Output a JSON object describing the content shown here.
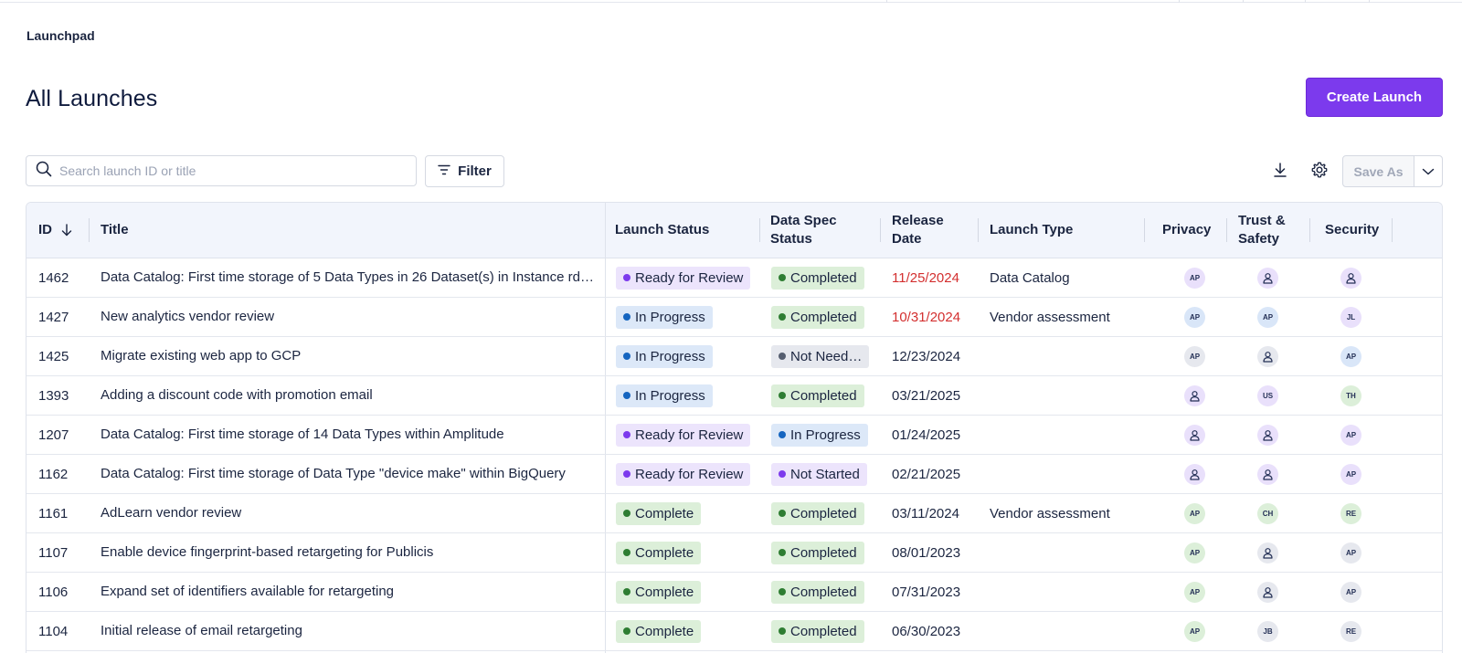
{
  "breadcrumb": "Launchpad",
  "page_title": "All Launches",
  "create_button": "Create Launch",
  "search": {
    "placeholder": "Search launch ID or title"
  },
  "filter_label": "Filter",
  "save_as_label": "Save As",
  "colors": {
    "accent": "#7c3aed",
    "overdue": "#d32f2f",
    "header_bg": "#f2f5fc"
  },
  "columns": {
    "id": "ID",
    "title": "Title",
    "launch_status": "Launch Status",
    "data_spec_status_1": "Data Spec",
    "data_spec_status_2": "Status",
    "release_date_1": "Release",
    "release_date_2": "Date",
    "launch_type": "Launch Type",
    "privacy": "Privacy",
    "trust_1": "Trust &",
    "trust_2": "Safety",
    "security": "Security"
  },
  "rows": [
    {
      "id": "1462",
      "title": "Data Catalog: First time storage of 5 Data Types in 26 Dataset(s) in Instance rds-s…",
      "launch_status": "Ready for Review",
      "launch_color": "purple",
      "data_spec": "Completed",
      "data_color": "green",
      "release_date": "11/25/2024",
      "overdue": true,
      "launch_type": "Data Catalog",
      "privacy": {
        "initials": "AP",
        "color": "purple",
        "icon": false
      },
      "trust": {
        "initials": "",
        "color": "purple",
        "icon": true
      },
      "security": {
        "initials": "",
        "color": "purple",
        "icon": true
      }
    },
    {
      "id": "1427",
      "title": "New analytics vendor review",
      "launch_status": "In Progress",
      "launch_color": "blue",
      "data_spec": "Completed",
      "data_color": "green",
      "release_date": "10/31/2024",
      "overdue": true,
      "launch_type": "Vendor assessment",
      "privacy": {
        "initials": "AP",
        "color": "blue",
        "icon": false
      },
      "trust": {
        "initials": "AP",
        "color": "blue",
        "icon": false
      },
      "security": {
        "initials": "JL",
        "color": "purple",
        "icon": false
      }
    },
    {
      "id": "1425",
      "title": "Migrate existing web app to GCP",
      "launch_status": "In Progress",
      "launch_color": "blue",
      "data_spec": "Not Need…",
      "data_color": "gray",
      "release_date": "12/23/2024",
      "overdue": false,
      "launch_type": "",
      "privacy": {
        "initials": "AP",
        "color": "gray",
        "icon": false
      },
      "trust": {
        "initials": "",
        "color": "gray",
        "icon": true
      },
      "security": {
        "initials": "AP",
        "color": "blue",
        "icon": false
      }
    },
    {
      "id": "1393",
      "title": "Adding a discount code with promotion email",
      "launch_status": "In Progress",
      "launch_color": "blue",
      "data_spec": "Completed",
      "data_color": "green",
      "release_date": "03/21/2025",
      "overdue": false,
      "launch_type": "",
      "privacy": {
        "initials": "",
        "color": "purple",
        "icon": true
      },
      "trust": {
        "initials": "US",
        "color": "purple",
        "icon": false
      },
      "security": {
        "initials": "TH",
        "color": "green",
        "icon": false
      }
    },
    {
      "id": "1207",
      "title": "Data Catalog: First time storage of 14 Data Types within Amplitude",
      "launch_status": "Ready for Review",
      "launch_color": "purple",
      "data_spec": "In Progress",
      "data_color": "blue",
      "release_date": "01/24/2025",
      "overdue": false,
      "launch_type": "",
      "privacy": {
        "initials": "",
        "color": "purple",
        "icon": true
      },
      "trust": {
        "initials": "",
        "color": "purple",
        "icon": true
      },
      "security": {
        "initials": "AP",
        "color": "purple",
        "icon": false
      }
    },
    {
      "id": "1162",
      "title": "Data Catalog: First time storage of Data Type \"device make\" within BigQuery",
      "launch_status": "Ready for Review",
      "launch_color": "purple",
      "data_spec": "Not Started",
      "data_color": "purple",
      "release_date": "02/21/2025",
      "overdue": false,
      "launch_type": "",
      "privacy": {
        "initials": "",
        "color": "purple",
        "icon": true
      },
      "trust": {
        "initials": "",
        "color": "purple",
        "icon": true
      },
      "security": {
        "initials": "AP",
        "color": "purple",
        "icon": false
      }
    },
    {
      "id": "1161",
      "title": "AdLearn vendor review",
      "launch_status": "Complete",
      "launch_color": "green",
      "data_spec": "Completed",
      "data_color": "green",
      "release_date": "03/11/2024",
      "overdue": false,
      "launch_type": "Vendor assessment",
      "privacy": {
        "initials": "AP",
        "color": "green",
        "icon": false
      },
      "trust": {
        "initials": "CH",
        "color": "green",
        "icon": false
      },
      "security": {
        "initials": "RE",
        "color": "green",
        "icon": false
      }
    },
    {
      "id": "1107",
      "title": "Enable device fingerprint-based retargeting for Publicis",
      "launch_status": "Complete",
      "launch_color": "green",
      "data_spec": "Completed",
      "data_color": "green",
      "release_date": "08/01/2023",
      "overdue": false,
      "launch_type": "",
      "privacy": {
        "initials": "AP",
        "color": "green",
        "icon": false
      },
      "trust": {
        "initials": "",
        "color": "gray",
        "icon": true
      },
      "security": {
        "initials": "AP",
        "color": "gray",
        "icon": false
      }
    },
    {
      "id": "1106",
      "title": "Expand set of identifiers available for retargeting",
      "launch_status": "Complete",
      "launch_color": "green",
      "data_spec": "Completed",
      "data_color": "green",
      "release_date": "07/31/2023",
      "overdue": false,
      "launch_type": "",
      "privacy": {
        "initials": "AP",
        "color": "green",
        "icon": false
      },
      "trust": {
        "initials": "",
        "color": "gray",
        "icon": true
      },
      "security": {
        "initials": "AP",
        "color": "gray",
        "icon": false
      }
    },
    {
      "id": "1104",
      "title": "Initial release of email retargeting",
      "launch_status": "Complete",
      "launch_color": "green",
      "data_spec": "Completed",
      "data_color": "green",
      "release_date": "06/30/2023",
      "overdue": false,
      "launch_type": "",
      "privacy": {
        "initials": "AP",
        "color": "green",
        "icon": false
      },
      "trust": {
        "initials": "JB",
        "color": "gray",
        "icon": false
      },
      "security": {
        "initials": "RE",
        "color": "gray",
        "icon": false
      }
    }
  ]
}
